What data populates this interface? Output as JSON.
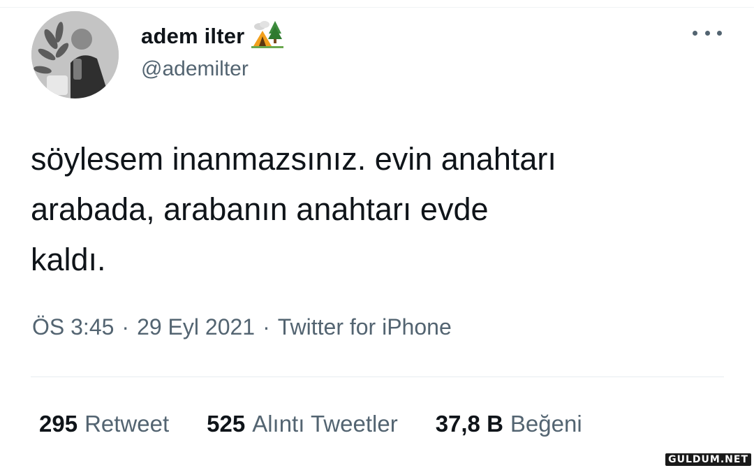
{
  "tweet": {
    "author": {
      "display_name": "adem ilter",
      "display_name_emoji": "camping-emoji",
      "handle": "@ademilter",
      "avatar": "avatar"
    },
    "text": "söylesem inanmazsınız. evin anahtarı\narabada, arabanın anahtarı evde\nkaldı.",
    "time": "ÖS 3:45",
    "date": "29 Eyl 2021",
    "source": "Twitter for iPhone",
    "separator": "·",
    "more_icon": "more-horizontal-icon",
    "stats": {
      "retweets": {
        "count": "295",
        "label": "Retweet"
      },
      "quotes": {
        "count": "525",
        "label": "Alıntı Tweetler"
      },
      "likes": {
        "count": "37,8 B",
        "label": "Beğeni"
      }
    }
  },
  "watermark": "GULDUM.NET",
  "colors": {
    "text_primary": "#0f1419",
    "text_secondary": "#536471",
    "divider": "#e6ecf0",
    "background": "#ffffff"
  }
}
